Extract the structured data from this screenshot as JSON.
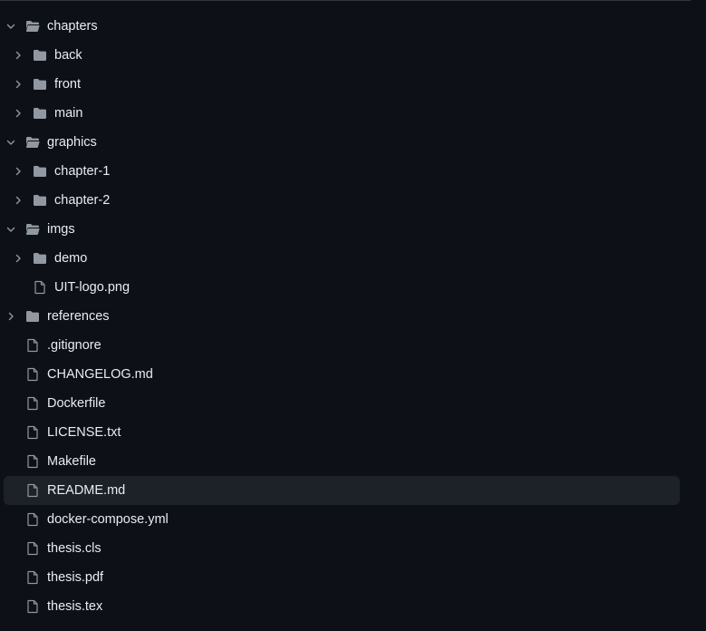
{
  "tree": {
    "items": [
      {
        "label": "chapters",
        "type": "folder",
        "expanded": true,
        "level": 0,
        "icon": "folder-open-icon",
        "chevron": "chevron-down-icon"
      },
      {
        "label": "back",
        "type": "folder",
        "expanded": false,
        "level": 1,
        "icon": "folder-icon",
        "chevron": "chevron-right-icon"
      },
      {
        "label": "front",
        "type": "folder",
        "expanded": false,
        "level": 1,
        "icon": "folder-icon",
        "chevron": "chevron-right-icon"
      },
      {
        "label": "main",
        "type": "folder",
        "expanded": false,
        "level": 1,
        "icon": "folder-icon",
        "chevron": "chevron-right-icon"
      },
      {
        "label": "graphics",
        "type": "folder",
        "expanded": true,
        "level": 0,
        "icon": "folder-open-icon",
        "chevron": "chevron-down-icon"
      },
      {
        "label": "chapter-1",
        "type": "folder",
        "expanded": false,
        "level": 1,
        "icon": "folder-icon",
        "chevron": "chevron-right-icon"
      },
      {
        "label": "chapter-2",
        "type": "folder",
        "expanded": false,
        "level": 1,
        "icon": "folder-icon",
        "chevron": "chevron-right-icon"
      },
      {
        "label": "imgs",
        "type": "folder",
        "expanded": true,
        "level": 0,
        "icon": "folder-open-icon",
        "chevron": "chevron-down-icon"
      },
      {
        "label": "demo",
        "type": "folder",
        "expanded": false,
        "level": 1,
        "icon": "folder-icon",
        "chevron": "chevron-right-icon"
      },
      {
        "label": "UIT-logo.png",
        "type": "file",
        "level": 1,
        "icon": "file-icon"
      },
      {
        "label": "references",
        "type": "folder",
        "expanded": false,
        "level": 0,
        "icon": "folder-icon",
        "chevron": "chevron-right-icon"
      },
      {
        "label": ".gitignore",
        "type": "file",
        "level": 0,
        "icon": "file-icon"
      },
      {
        "label": "CHANGELOG.md",
        "type": "file",
        "level": 0,
        "icon": "file-icon"
      },
      {
        "label": "Dockerfile",
        "type": "file",
        "level": 0,
        "icon": "file-icon"
      },
      {
        "label": "LICENSE.txt",
        "type": "file",
        "level": 0,
        "icon": "file-icon"
      },
      {
        "label": "Makefile",
        "type": "file",
        "level": 0,
        "icon": "file-icon"
      },
      {
        "label": "README.md",
        "type": "file",
        "level": 0,
        "icon": "file-icon",
        "selected": true
      },
      {
        "label": "docker-compose.yml",
        "type": "file",
        "level": 0,
        "icon": "file-icon"
      },
      {
        "label": "thesis.cls",
        "type": "file",
        "level": 0,
        "icon": "file-icon"
      },
      {
        "label": "thesis.pdf",
        "type": "file",
        "level": 0,
        "icon": "file-icon"
      },
      {
        "label": "thesis.tex",
        "type": "file",
        "level": 0,
        "icon": "file-icon"
      }
    ]
  },
  "colors": {
    "background": "#0d1117",
    "text": "#e6edf3",
    "icon": "#9198a1",
    "selected_row": "#1d2229",
    "divider": "#30363d"
  }
}
